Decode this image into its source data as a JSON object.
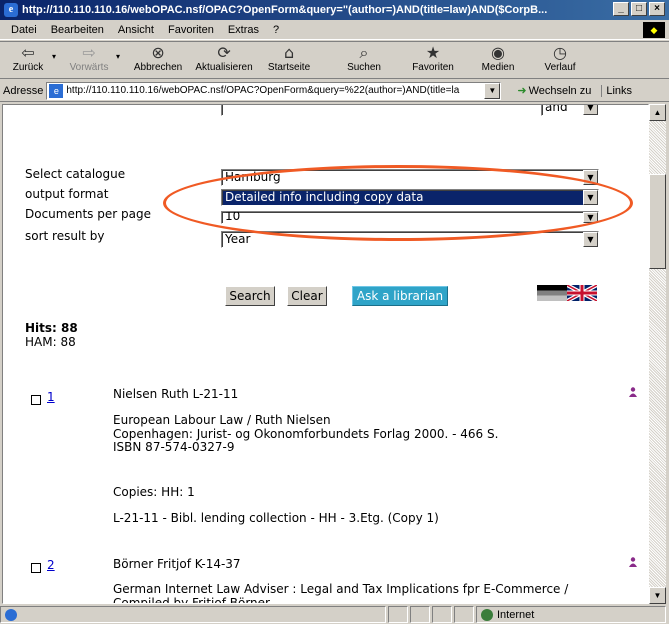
{
  "window": {
    "title": "http://110.110.110.16/webOPAC.nsf/OPAC?OpenForm&query=\"(author=)AND(title=law)AND($CorpB...",
    "controls": [
      "_",
      "□",
      "×"
    ]
  },
  "menu": [
    "Datei",
    "Bearbeiten",
    "Ansicht",
    "Favoriten",
    "Extras",
    "?"
  ],
  "toolbar": {
    "back": "Zurück",
    "forward": "Vorwärts",
    "stop": "Abbrechen",
    "refresh": "Aktualisieren",
    "home": "Startseite",
    "search": "Suchen",
    "favorites": "Favoriten",
    "media": "Medien",
    "history": "Verlauf"
  },
  "address": {
    "label": "Adresse",
    "url": "http://110.110.110.16/webOPAC.nsf/OPAC?OpenForm&query=%22(author=)AND(title=la",
    "go": "Wechseln zu",
    "links": "Links"
  },
  "form": {
    "select_catalogue_label": "Select catalogue",
    "select_catalogue_value": "Hamburg",
    "output_format_label": "output format",
    "output_format_value": "Detailed info including copy data",
    "docs_per_page_label": "Documents per page",
    "docs_per_page_value": "10",
    "sort_label": "sort result by",
    "sort_value": "Year",
    "and_value": "and",
    "search_btn": "Search",
    "clear_btn": "Clear",
    "ask_btn": "Ask a librarian"
  },
  "hits": {
    "total": "Hits: 88",
    "ham": "HAM: 88"
  },
  "results": [
    {
      "number": "1",
      "heading": "Nielsen Ruth L-21-11",
      "title": "European Labour Law / Ruth Nielsen",
      "imprint": "Copenhagen: Jurist- og Okonomforbundets Forlag 2000. - 466 S.",
      "isbn": "ISBN 87-574-0327-9",
      "copies": "Copies: HH: 1",
      "location": "L-21-11 - Bibl. lending collection - HH - 3.Etg. (Copy 1)"
    },
    {
      "number": "2",
      "heading": "Börner Fritjof K-14-37",
      "title": "German Internet Law Adviser : Legal and Tax Implications fpr E-Commerce /",
      "compiled": "Compiled by Fritjof Börner"
    }
  ],
  "status": {
    "zone": "Internet"
  },
  "colors": {
    "highlight_ellipse": "#f05a24",
    "selected_option_bg": "#0a246a",
    "ask_button_bg": "#2fa4c8"
  }
}
